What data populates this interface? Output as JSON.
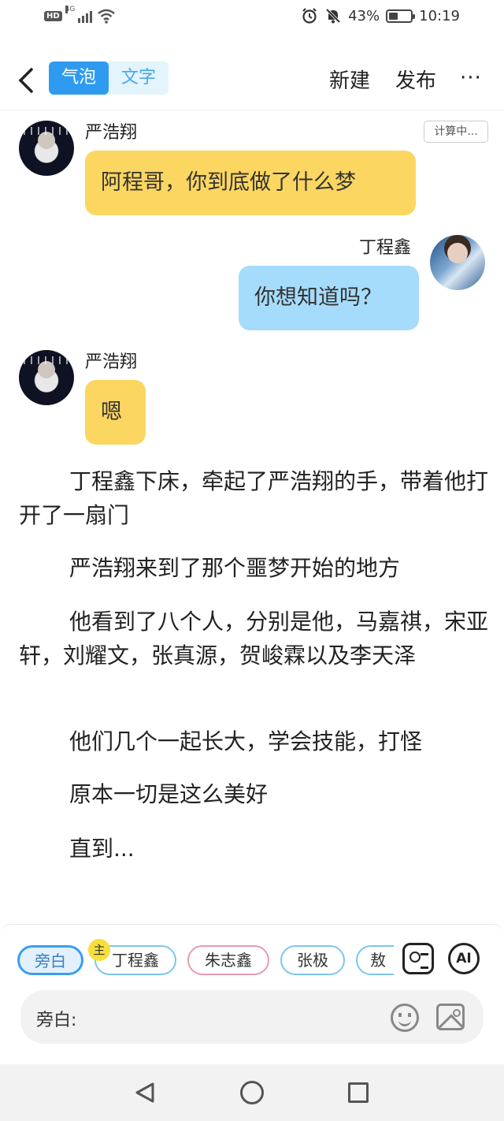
{
  "status_bar": {
    "hd": "HD",
    "network": "4G",
    "battery_percent": "43%",
    "battery_level": 0.43,
    "time": "10:19",
    "icons": [
      "signal-icon",
      "wifi-icon",
      "alarm-icon",
      "mute-icon",
      "battery-icon"
    ]
  },
  "header": {
    "tabs": [
      {
        "label": "气泡",
        "active": true
      },
      {
        "label": "文字",
        "active": false
      }
    ],
    "new_label": "新建",
    "publish_label": "发布",
    "more_label": "···"
  },
  "calc_badge": "计算中...",
  "messages": [
    {
      "speaker": "严浩翔",
      "text": "阿程哥，你到底做了什么梦",
      "side": "left",
      "color": "#fbd661"
    },
    {
      "speaker": "丁程鑫",
      "text": "你想知道吗？",
      "side": "right",
      "color": "#a6dcfb"
    },
    {
      "speaker": "严浩翔",
      "text": "嗯",
      "side": "left",
      "color": "#fbd661"
    }
  ],
  "narration": [
    "丁程鑫下床，牵起了严浩翔的手，带着他打开了一扇门",
    "严浩翔来到了那个噩梦开始的地方",
    "他看到了八个人，分别是他，马嘉祺，宋亚轩，刘耀文，张真源，贺峻霖以及李天泽",
    "他们几个一起长大，学会技能，打怪",
    "原本一切是这么美好",
    "直到..."
  ],
  "roles": [
    {
      "label": "旁白",
      "selected": true
    },
    {
      "label": "丁程鑫",
      "badge": "主"
    },
    {
      "label": "朱志鑫"
    },
    {
      "label": "张极"
    },
    {
      "label": "敖"
    }
  ],
  "ai_label": "AI",
  "input": {
    "label": "旁白:"
  }
}
